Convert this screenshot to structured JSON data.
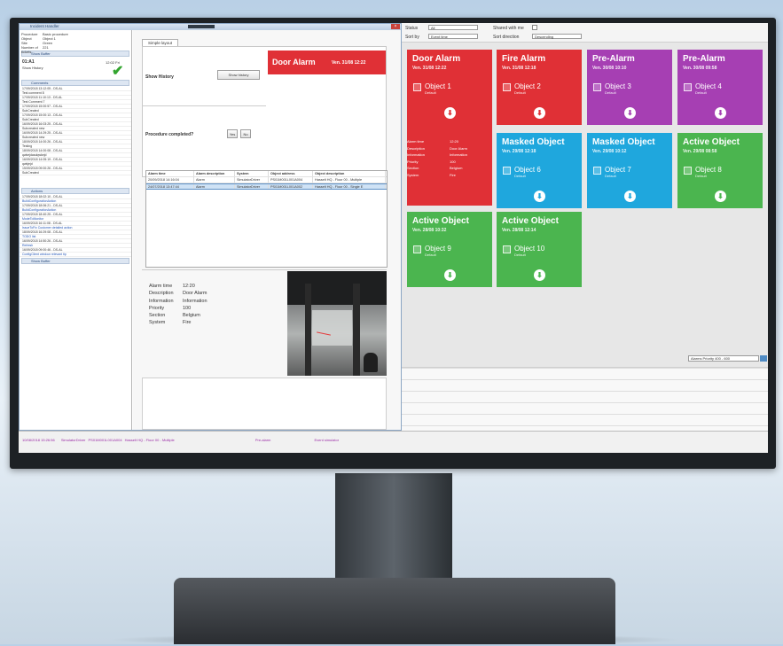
{
  "window": {
    "title": "Incident Handler"
  },
  "info": [
    {
      "k": "Procedure",
      "v": "Basic procedure"
    },
    {
      "k": "Object",
      "v": "Object 1"
    },
    {
      "k": "Site",
      "v": "Green"
    },
    {
      "k": "Number of tickets",
      "v": "221"
    }
  ],
  "show_buffer": "Show Buffer",
  "step": {
    "code": "01:A1",
    "time": "12:02 Fri",
    "label": "Show History"
  },
  "comments_header": "Comments",
  "comments": [
    "17/09/2018 13:12:05 - DS-AL",
    "Test comment 8",
    "17/09/2018 11:10:13 - DS-AL",
    "Test Comment 7",
    "17/09/2018 15:00:57 - DS-AL",
    "SubCreated",
    "17/09/2018 15:00:13 - DS-AL",
    "SubCreated",
    "16/09/2018 16:03:25 - DS-AL",
    "Subcreated new",
    "16/09/2018 14:29:25 - DS-AL",
    "Subcreated new",
    "18/09/2018 14:00:26 - DS-AL",
    "Testing",
    "18/09/2018 14:00:08 - DS-AL",
    "qwkejdasdqwkejd",
    "16/09/2018 14:05:19 - DS-AL",
    "qwkjejd",
    "15/09/2018 09:00:26 - DS-AL",
    "SubCreated"
  ],
  "actions_header": "Actions",
  "actions": [
    "17/09/2018 18:02:10 - DS-AL",
    "BuildConfigurationAction",
    "17/09/2018 18:06:21 - DS-AL",
    "BuildConfigurationAction",
    "17/09/2018 18:40:25 - DS-AL",
    "ModeToMonitor",
    "16/09/2018 16:11:08 - DS-AL",
    "IssueToFix Customer detailed action",
    "18/09/2018 16:29:08 - DS-AL",
    "TODO list",
    "16/09/2018 14:50:26 - DS-AL",
    "Refresh",
    "16/09/2018 09:00:46 - DS-AL",
    "ConfigClient window relevant tip"
  ],
  "show_buffer2": "Show Buffer",
  "layout_tab": "Simple layout",
  "main": {
    "show_history": "Show History",
    "show_history_btn": "Show history",
    "procedure_completed": "Procedure completed?",
    "yes": "Yes",
    "no": "No"
  },
  "alarm_header": {
    "title": "Door Alarm",
    "date": "Ven. 31/08 12:22"
  },
  "table": {
    "headers": [
      "Alarm time",
      "Alarm description",
      "System",
      "Object address",
      "Object description"
    ],
    "rows": [
      [
        "20/09/2018 14:16:04",
        "Alarm",
        "SimulatorDriver",
        "PS01M001L001A004",
        "Hasselt HQ - Floor 00 - Multiple"
      ],
      [
        "24/07/2018 13:47:44",
        "Alarm",
        "SimulatorDriver",
        "PS01M001L001A002",
        "Hasselt HQ - Floor 00 - Single E"
      ]
    ]
  },
  "details": [
    {
      "k": "Alarm time",
      "v": "12:20"
    },
    {
      "k": "Description",
      "v": "Door Alarm"
    },
    {
      "k": "Information",
      "v": "Information"
    },
    {
      "k": "Priority",
      "v": "100"
    },
    {
      "k": "Section",
      "v": "Belgium"
    },
    {
      "k": "System",
      "v": "Fire"
    }
  ],
  "filters": {
    "status_label": "Status",
    "status_value": "All",
    "sort_by_label": "Sort by",
    "sort_by_value": "Event time",
    "shared_label": "Shared with me",
    "sort_dir_label": "Sort direction",
    "sort_dir_value": "Descending"
  },
  "tiles": [
    {
      "title": "Door Alarm",
      "date": "Ven. 31/08 12:22",
      "object": "Object 1",
      "sub": "Default",
      "color": "red"
    },
    {
      "title": "Fire Alarm",
      "date": "Ven. 31/08 12:18",
      "object": "Object 2",
      "sub": "Default",
      "color": "red"
    },
    {
      "title": "Pre-Alarm",
      "date": "Ven. 30/08 10:10",
      "object": "Object 3",
      "sub": "Default",
      "color": "purple"
    },
    {
      "title": "Pre-Alarm",
      "date": "Ven. 30/08 09:58",
      "object": "Object 4",
      "sub": "Default",
      "color": "purple"
    },
    {
      "title": "Masked Object",
      "date": "Ven. 29/08 12:18",
      "object": "Object 6",
      "sub": "Default",
      "color": "blue"
    },
    {
      "title": "Masked Object",
      "date": "Ven. 29/08 10:12",
      "object": "Object 7",
      "sub": "Default",
      "color": "blue"
    },
    {
      "title": "Active Object",
      "date": "Ven. 29/08 08:58",
      "object": "Object 8",
      "sub": "Default",
      "color": "green"
    },
    {
      "title": "Active Object",
      "date": "Ven. 28/08 10:32",
      "object": "Object 9",
      "sub": "Default",
      "color": "green"
    },
    {
      "title": "Active Object",
      "date": "Ven. 28/08 12:14",
      "object": "Object 10",
      "sub": "Default",
      "color": "green"
    }
  ],
  "expanded": [
    {
      "k": "Alarm time",
      "v": "12:20"
    },
    {
      "k": "Description",
      "v": "Door Alarm"
    },
    {
      "k": "Information",
      "v": "Information"
    },
    {
      "k": "Priority",
      "v": "100"
    },
    {
      "k": "Section",
      "v": "Belgium"
    },
    {
      "k": "System",
      "v": "Fire"
    }
  ],
  "priority_select": "Alarms Priority 400 - 600",
  "event": {
    "time": "10/08/2018 15:26:56",
    "system": "SimulatorDriver",
    "address": "PS01M001L001A004",
    "description": "Hasselt HQ - Floor 00 - Multiple",
    "type": "Pre-alarm",
    "source": "Event simulator"
  }
}
